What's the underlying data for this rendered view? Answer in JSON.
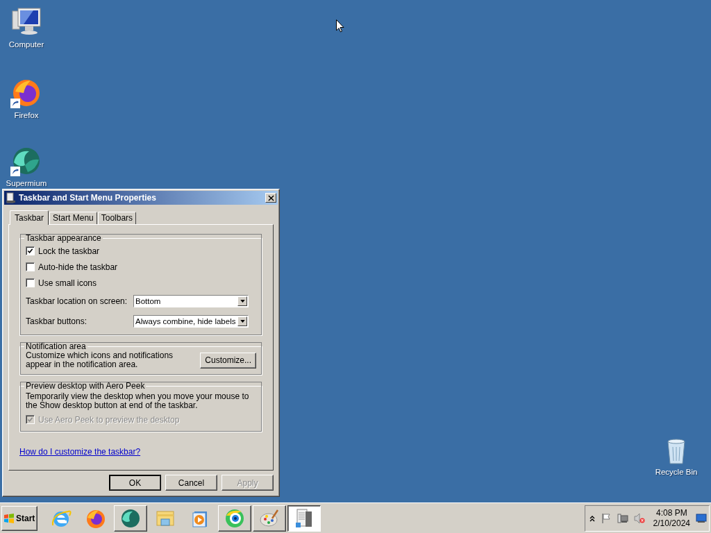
{
  "desktop": {
    "icons": [
      {
        "label": "Computer",
        "kind": "computer",
        "shortcut": false
      },
      {
        "label": "Firefox",
        "kind": "firefox",
        "shortcut": true
      },
      {
        "label": "Supermium",
        "kind": "supermium",
        "shortcut": true
      },
      {
        "label": "Recycle Bin",
        "kind": "recycle",
        "shortcut": false
      }
    ]
  },
  "dialog": {
    "title": "Taskbar and Start Menu Properties",
    "tabs": [
      {
        "label": "Taskbar",
        "selected": true
      },
      {
        "label": "Start Menu",
        "selected": false
      },
      {
        "label": "Toolbars",
        "selected": false
      }
    ],
    "appearance": {
      "title": "Taskbar appearance",
      "checkboxes": [
        {
          "label": "Lock the taskbar",
          "checked": true
        },
        {
          "label": "Auto-hide the taskbar",
          "checked": false
        },
        {
          "label": "Use small icons",
          "checked": false
        }
      ],
      "dropdowns": [
        {
          "label": "Taskbar location on screen:",
          "value": "Bottom"
        },
        {
          "label": "Taskbar buttons:",
          "value": "Always combine, hide labels"
        }
      ]
    },
    "notification": {
      "title": "Notification area",
      "text": "Customize which icons and notifications appear in the notification area.",
      "button": "Customize..."
    },
    "peek": {
      "title": "Preview desktop with Aero Peek",
      "text": "Temporarily view the desktop when you move your mouse to the Show desktop button at end of the taskbar.",
      "checkbox": {
        "label": "Use Aero Peek to preview the desktop",
        "checked": true,
        "disabled": true
      }
    },
    "help_link": "How do I customize the taskbar?",
    "buttons": [
      {
        "label": "OK",
        "default": true,
        "disabled": false
      },
      {
        "label": "Cancel",
        "default": false,
        "disabled": false
      },
      {
        "label": "Apply",
        "default": false,
        "disabled": true
      }
    ]
  },
  "taskbar": {
    "start": "Start",
    "items": [
      {
        "kind": "ie",
        "running": false,
        "active": false
      },
      {
        "kind": "firefox",
        "running": false,
        "active": false
      },
      {
        "kind": "supermium",
        "running": true,
        "active": false
      },
      {
        "kind": "folder",
        "running": false,
        "active": false
      },
      {
        "kind": "media",
        "running": false,
        "active": false
      },
      {
        "kind": "eye",
        "running": true,
        "active": false
      },
      {
        "kind": "paint",
        "running": true,
        "active": false
      },
      {
        "kind": "server",
        "running": true,
        "active": true
      }
    ],
    "clock": {
      "time": "4:08 PM",
      "date": "2/10/2024"
    }
  }
}
